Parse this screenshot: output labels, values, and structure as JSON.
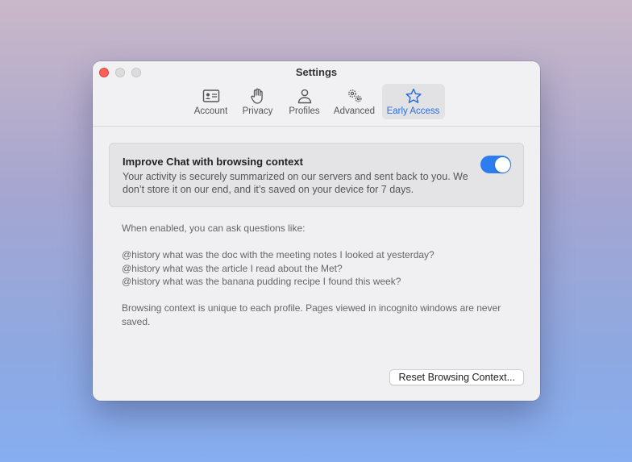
{
  "window": {
    "title": "Settings"
  },
  "tabs": [
    {
      "label": "Account",
      "icon": "account-card-icon",
      "active": false
    },
    {
      "label": "Privacy",
      "icon": "hand-icon",
      "active": false
    },
    {
      "label": "Profiles",
      "icon": "person-icon",
      "active": false
    },
    {
      "label": "Advanced",
      "icon": "gears-icon",
      "active": false
    },
    {
      "label": "Early Access",
      "icon": "star-icon",
      "active": true
    }
  ],
  "feature": {
    "title": "Improve Chat with browsing context",
    "description": "Your activity is securely summarized on our servers and sent back to you. We don’t store it on our end, and it’s saved on your device for 7 days.",
    "enabled": true
  },
  "info": {
    "intro": "When enabled, you can ask questions like:",
    "examples": [
      "@history what was the doc with the meeting notes I looked at yesterday?",
      "@history what was the article I read about the Met?",
      "@history what was the banana pudding recipe I found this week?"
    ],
    "note": "Browsing context is unique to each profile. Pages viewed in incognito windows are never saved."
  },
  "reset_button": {
    "label": "Reset Browsing Context..."
  },
  "colors": {
    "accent": "#2b6fde",
    "toggle_on": "#2d7df0",
    "close_light": "#fe5f57"
  }
}
